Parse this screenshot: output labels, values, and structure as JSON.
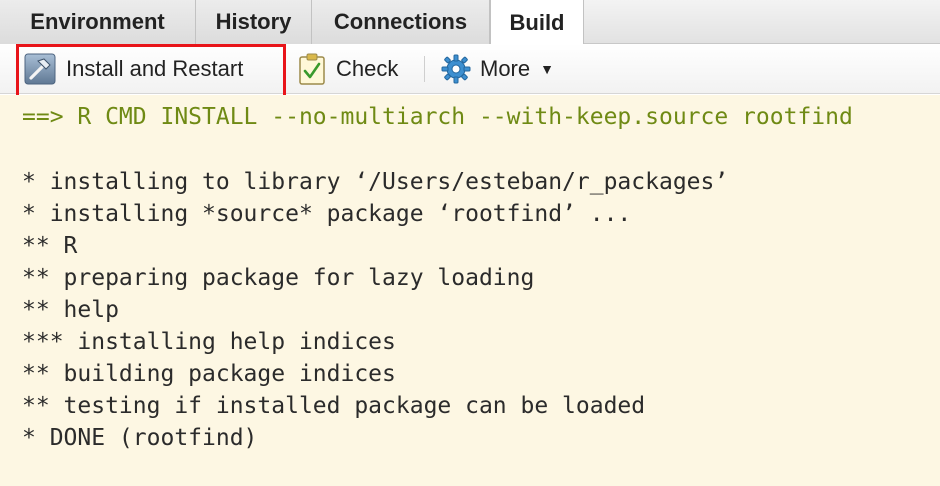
{
  "tabs": [
    {
      "label": "Environment",
      "active": false
    },
    {
      "label": "History",
      "active": false
    },
    {
      "label": "Connections",
      "active": false
    },
    {
      "label": "Build",
      "active": true
    }
  ],
  "toolbar": {
    "install_restart_label": "Install and Restart",
    "check_label": "Check",
    "more_label": "More",
    "install_icon": "hammer-icon",
    "check_icon": "clipboard-check-icon",
    "more_icon": "gear-icon",
    "highlight_color": "#e8141a"
  },
  "console": {
    "command": "==> R CMD INSTALL --no-multiarch --with-keep.source rootfind",
    "lines": [
      "* installing to library ‘/Users/esteban/r_packages’",
      "* installing *source* package ‘rootfind’ ...",
      "** R",
      "** preparing package for lazy loading",
      "** help",
      "*** installing help indices",
      "** building package indices",
      "** testing if installed package can be loaded",
      "* DONE (rootfind)"
    ],
    "command_color": "#6f8a14",
    "background": "#fdf7e3"
  }
}
